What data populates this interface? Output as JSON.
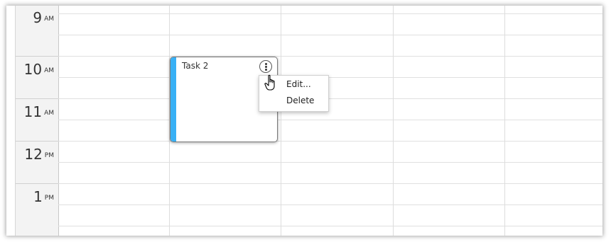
{
  "calendar": {
    "hours": [
      {
        "num": "9",
        "ampm": "AM"
      },
      {
        "num": "10",
        "ampm": "AM"
      },
      {
        "num": "11",
        "ampm": "AM"
      },
      {
        "num": "12",
        "ampm": "PM"
      },
      {
        "num": "1",
        "ampm": "PM"
      }
    ]
  },
  "event": {
    "title": "Task 2",
    "color": "#38b0f5"
  },
  "context_menu": {
    "items": [
      {
        "label": "Edit..."
      },
      {
        "label": "Delete"
      }
    ]
  },
  "icons": {
    "menu_button": "vertical-ellipsis-icon",
    "cursor": "hand-pointer-icon"
  }
}
